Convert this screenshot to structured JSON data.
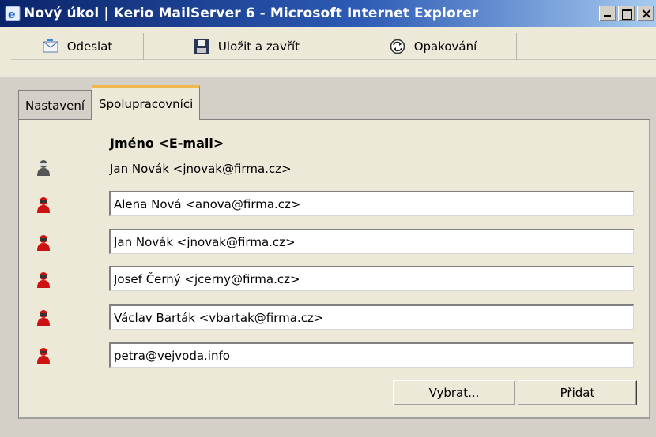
{
  "window": {
    "title": "Nový úkol | Kerio MailServer 6 - Microsoft Internet Explorer"
  },
  "toolbar": {
    "send_label": "Odeslat",
    "save_close_label": "Uložit a zavřít",
    "recurrence_label": "Opakování"
  },
  "tabs": [
    {
      "label": "Nastavení",
      "active": false
    },
    {
      "label": "Spolupracovníci",
      "active": true
    }
  ],
  "panel": {
    "column_header": "Jméno <E-mail>",
    "owner": "Jan Novák <jnovak@firma.cz>",
    "collaborators": [
      "Alena Nová <anova@firma.cz>",
      "Jan Novák <jnovak@firma.cz>",
      "Josef Černý <jcerny@firma.cz>",
      "Václav Barták <vbartak@firma.cz>",
      "petra@vejvoda.info"
    ],
    "select_button": "Vybrat...",
    "add_button": "Přidat"
  },
  "colors": {
    "title_gradient_start": "#0a246a",
    "owner_icon": "#555555",
    "collaborator_icon": "#cc1111",
    "active_tab_accent": "#f0b850"
  },
  "icons": {
    "title": "ie-icon",
    "send": "envelope-icon",
    "save": "floppy-disk-icon",
    "recurrence": "recurrence-icon",
    "owner": "owner-person-icon",
    "collaborator": "collaborator-person-icon"
  }
}
